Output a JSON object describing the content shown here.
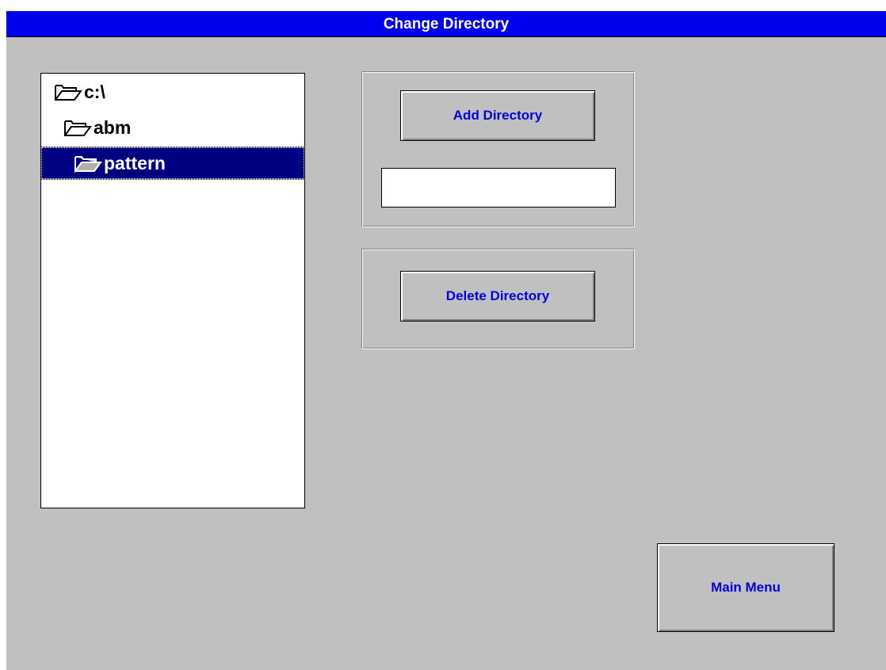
{
  "window": {
    "title": "Change Directory"
  },
  "tree": {
    "items": [
      {
        "label": "c:\\",
        "icon": "folder-open-icon",
        "selected": false
      },
      {
        "label": "abm",
        "icon": "folder-open-icon",
        "selected": false
      },
      {
        "label": "pattern",
        "icon": "folder-open-icon",
        "selected": true
      }
    ]
  },
  "add_group": {
    "button_label": "Add Directory",
    "input_value": "",
    "input_placeholder": ""
  },
  "delete_group": {
    "button_label": "Delete Directory"
  },
  "footer": {
    "main_menu_label": "Main Menu"
  },
  "colors": {
    "titlebar": "#0000f0",
    "background": "#c0c0c0",
    "selection": "#000080",
    "button_text": "#0000e0"
  }
}
